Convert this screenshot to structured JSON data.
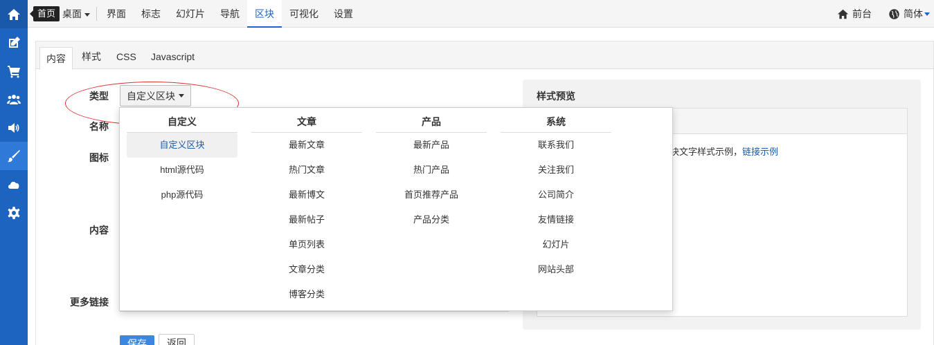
{
  "tooltip": "首页",
  "topbar": {
    "desk_label": "桌面",
    "nav": [
      "界面",
      "标志",
      "幻灯片",
      "导航",
      "区块",
      "可视化",
      "设置"
    ],
    "active_nav": "区块",
    "front": "前台",
    "language": "简体"
  },
  "sidebar": {
    "items": [
      "home-icon",
      "edit-icon",
      "cart-icon",
      "users-icon",
      "broadcast-icon",
      "brush-icon",
      "cloud-icon",
      "gear-icon"
    ]
  },
  "tabs": [
    "内容",
    "样式",
    "CSS",
    "Javascript"
  ],
  "form": {
    "type_label": "类型",
    "type_value": "自定义区块",
    "name_label": "名称",
    "icon_label": "图标",
    "content_label": "内容",
    "more_links_label": "更多链接",
    "save": "保存",
    "back": "返回"
  },
  "preview": {
    "title": "样式预览",
    "text": "块文字样式示例，",
    "link": "链接示例"
  },
  "dropdown": {
    "columns": [
      {
        "header": "自定义",
        "items": [
          "自定义区块",
          "html源代码",
          "php源代码"
        ]
      },
      {
        "header": "文章",
        "items": [
          "最新文章",
          "热门文章",
          "最新博文",
          "最新帖子",
          "单页列表",
          "文章分类",
          "博客分类"
        ]
      },
      {
        "header": "产品",
        "items": [
          "最新产品",
          "热门产品",
          "首页推荐产品",
          "产品分类"
        ]
      },
      {
        "header": "系统",
        "items": [
          "联系我们",
          "关注我们",
          "公司简介",
          "友情链接",
          "幻灯片",
          "网站头部"
        ]
      }
    ],
    "selected": "自定义区块"
  },
  "colors": {
    "sidebar": "#1d64c1",
    "accent": "#1d64c1",
    "annotation_ellipse": "#e03030"
  }
}
